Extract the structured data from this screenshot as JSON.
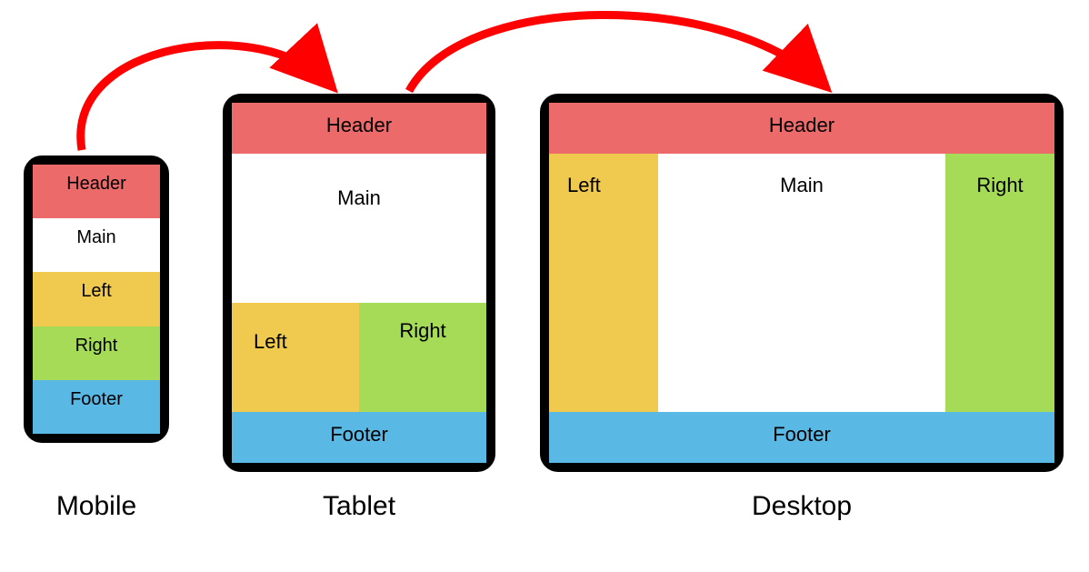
{
  "colors": {
    "header": "#ED6A6B",
    "main": "#FFFFFF",
    "left": "#EFCA4F",
    "right": "#A5DB57",
    "footer": "#5AB8E5",
    "frame": "#000000",
    "arrow": "#FF0000"
  },
  "regions": {
    "header": "Header",
    "main": "Main",
    "left": "Left",
    "right": "Right",
    "footer": "Footer"
  },
  "captions": {
    "mobile": "Mobile",
    "tablet": "Tablet",
    "desktop": "Desktop"
  },
  "layouts": {
    "mobile": {
      "order": [
        "header",
        "main",
        "left",
        "right",
        "footer"
      ],
      "columns": 1
    },
    "tablet": {
      "rows": [
        [
          "header",
          "header"
        ],
        [
          "main",
          "main"
        ],
        [
          "left",
          "right"
        ],
        [
          "footer",
          "footer"
        ]
      ]
    },
    "desktop": {
      "rows": [
        [
          "header",
          "header",
          "header"
        ],
        [
          "left",
          "main",
          "right"
        ],
        [
          "footer",
          "footer",
          "footer"
        ]
      ]
    }
  }
}
